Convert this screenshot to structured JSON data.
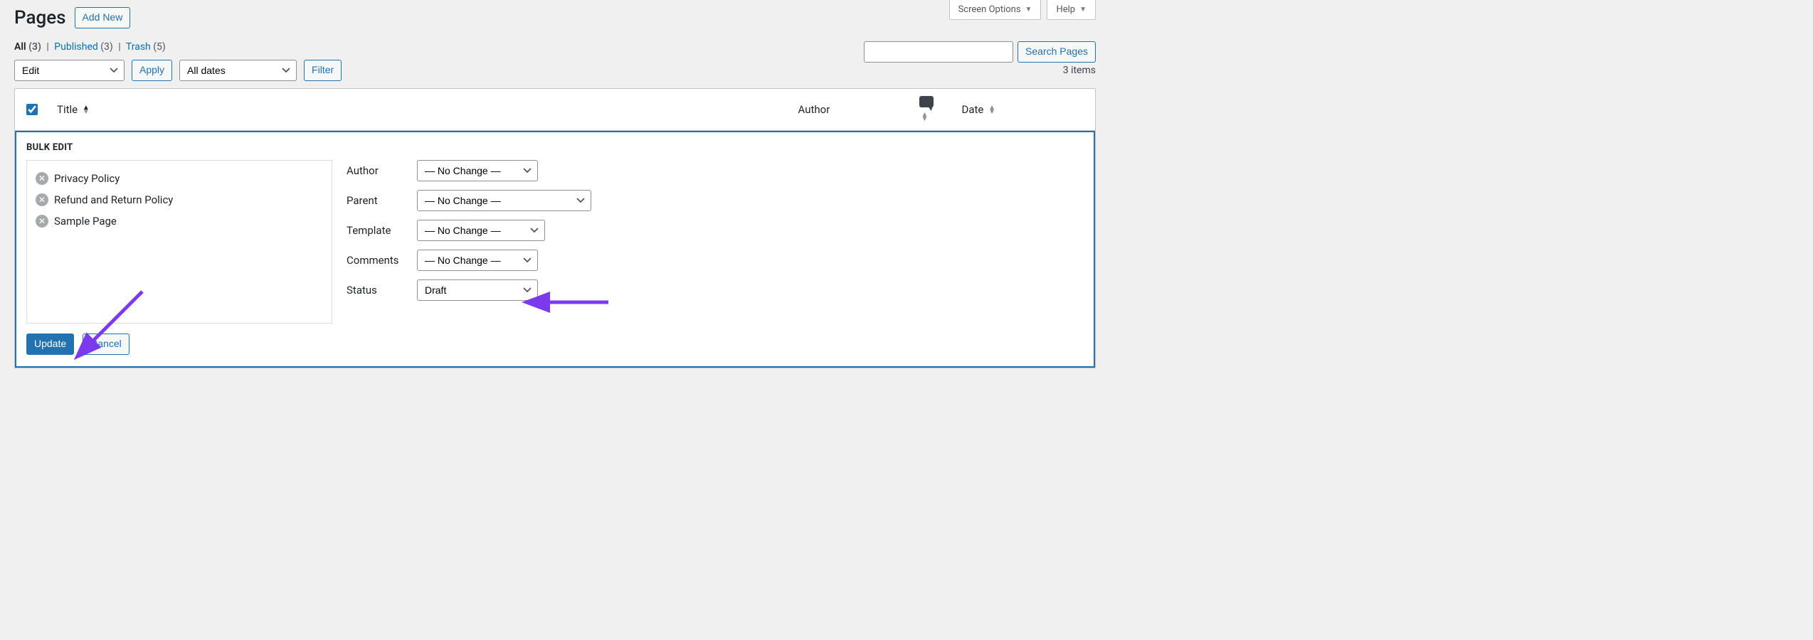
{
  "header": {
    "title": "Pages",
    "add_new": "Add New",
    "screen_options": "Screen Options",
    "help": "Help"
  },
  "views": {
    "all_label": "All",
    "all_count": "(3)",
    "published_label": "Published",
    "published_count": "(3)",
    "trash_label": "Trash",
    "trash_count": "(5)"
  },
  "search": {
    "button": "Search Pages",
    "placeholder": ""
  },
  "tablenav": {
    "bulk_action_value": "Edit",
    "apply": "Apply",
    "date_filter": "All dates",
    "filter": "Filter",
    "items_count": "3 items"
  },
  "columns": {
    "title": "Title",
    "author": "Author",
    "date": "Date"
  },
  "bulk_edit": {
    "heading": "BULK EDIT",
    "selected": [
      "Privacy Policy",
      "Refund and Return Policy",
      "Sample Page"
    ],
    "labels": {
      "author": "Author",
      "parent": "Parent",
      "template": "Template",
      "comments": "Comments",
      "status": "Status"
    },
    "values": {
      "author": "— No Change —",
      "parent": "— No Change —",
      "template": "— No Change —",
      "comments": "— No Change —",
      "status": "Draft"
    },
    "update": "Update",
    "cancel": "Cancel"
  },
  "annotation": {
    "color": "#7c3aed"
  }
}
